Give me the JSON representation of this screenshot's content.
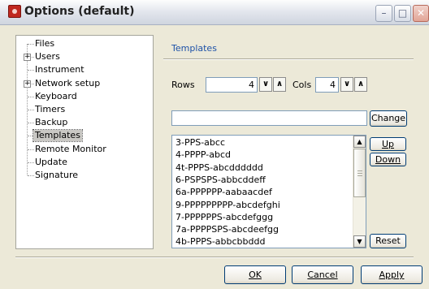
{
  "window": {
    "title": "Options (default)"
  },
  "tree": {
    "items": [
      {
        "label": "Files",
        "expandable": false,
        "selected": false
      },
      {
        "label": "Users",
        "expandable": true,
        "selected": false
      },
      {
        "label": "Instrument",
        "expandable": false,
        "selected": false
      },
      {
        "label": "Network setup",
        "expandable": true,
        "selected": false
      },
      {
        "label": "Keyboard",
        "expandable": false,
        "selected": false
      },
      {
        "label": "Timers",
        "expandable": false,
        "selected": false
      },
      {
        "label": "Backup",
        "expandable": false,
        "selected": false
      },
      {
        "label": "Templates",
        "expandable": false,
        "selected": true
      },
      {
        "label": "Remote Monitor",
        "expandable": false,
        "selected": false
      },
      {
        "label": "Update",
        "expandable": false,
        "selected": false
      },
      {
        "label": "Signature",
        "expandable": false,
        "selected": false
      }
    ]
  },
  "panel": {
    "title": "Templates",
    "rows_label": "Rows",
    "rows_value": "4",
    "cols_label": "Cols",
    "cols_value": "4",
    "template_name_value": "",
    "change_button": "Change",
    "up_button": "Up",
    "down_button": "Down",
    "reset_button": "Reset",
    "templates": [
      "3-PPS-abcc",
      "4-PPPP-abcd",
      "4t-PPPS-abcdddddd",
      "6-PSPSPS-abbcddeff",
      "6a-PPPPPP-aabaacdef",
      "9-PPPPPPPPP-abcdefghi",
      "7-PPPPPPS-abcdefggg",
      "7a-PPPPSPS-abcdeefgg",
      "4b-PPPS-abbcbbddd"
    ]
  },
  "footer": {
    "ok_button": "OK",
    "cancel_button": "Cancel",
    "apply_button": "Apply"
  },
  "colors": {
    "accent": "#1e52a8",
    "selection": "#c9c8c4",
    "face": "#ece9d8"
  }
}
